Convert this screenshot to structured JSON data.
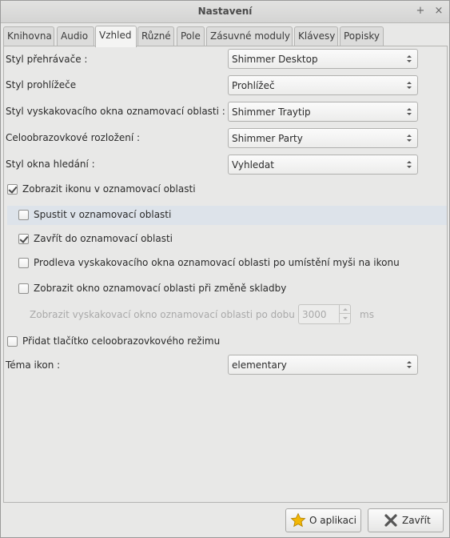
{
  "window": {
    "title": "Nastavení",
    "pin_glyph": "+",
    "close_glyph": "×"
  },
  "tabs": [
    {
      "label": "Knihovna"
    },
    {
      "label": "Audio"
    },
    {
      "label": "Vzhled"
    },
    {
      "label": "Různé"
    },
    {
      "label": "Pole"
    },
    {
      "label": "Zásuvné moduly"
    },
    {
      "label": "Klávesy"
    },
    {
      "label": "Popisky"
    }
  ],
  "settings": {
    "player_style": {
      "label": "Styl přehrávače :",
      "value": "Shimmer Desktop"
    },
    "browser_style": {
      "label": "Styl prohlížeče",
      "value": "Prohlížeč"
    },
    "tray_popup_style": {
      "label": "Styl vyskakovacího okna oznamovací oblasti :",
      "value": "Shimmer Traytip"
    },
    "fullscreen_layout": {
      "label": "Celoobrazovkové rozložení :",
      "value": "Shimmer Party"
    },
    "search_window_style": {
      "label": "Styl okna hledání :",
      "value": "Vyhledat"
    },
    "show_tray_icon": {
      "label": "Zobrazit ikonu v oznamovací oblasti",
      "checked": true
    },
    "start_in_tray": {
      "label": "Spustit v oznamovací oblasti",
      "checked": false
    },
    "close_to_tray": {
      "label": "Zavřít do oznamovací oblasti",
      "checked": true
    },
    "popup_delay": {
      "label": "Prodleva vyskakovacího okna oznamovací oblasti po umístění myši na ikonu",
      "checked": false
    },
    "popup_on_track_change": {
      "label": "Zobrazit okno oznamovací oblasti při změně skladby",
      "checked": false
    },
    "popup_duration": {
      "label": "Zobrazit vyskakovací okno oznamovací oblasti po dobu",
      "value": "3000",
      "unit": "ms"
    },
    "fullscreen_button": {
      "label": "Přidat tlačítko celoobrazovkového režimu",
      "checked": false
    },
    "icon_theme": {
      "label": "Téma ikon :",
      "value": "elementary"
    }
  },
  "buttons": {
    "about": "O aplikaci",
    "close": "Zavřít"
  },
  "colors": {
    "star_icon": "#f2b705",
    "close_icon": "#555555",
    "highlight_row": "#dde3ea"
  }
}
